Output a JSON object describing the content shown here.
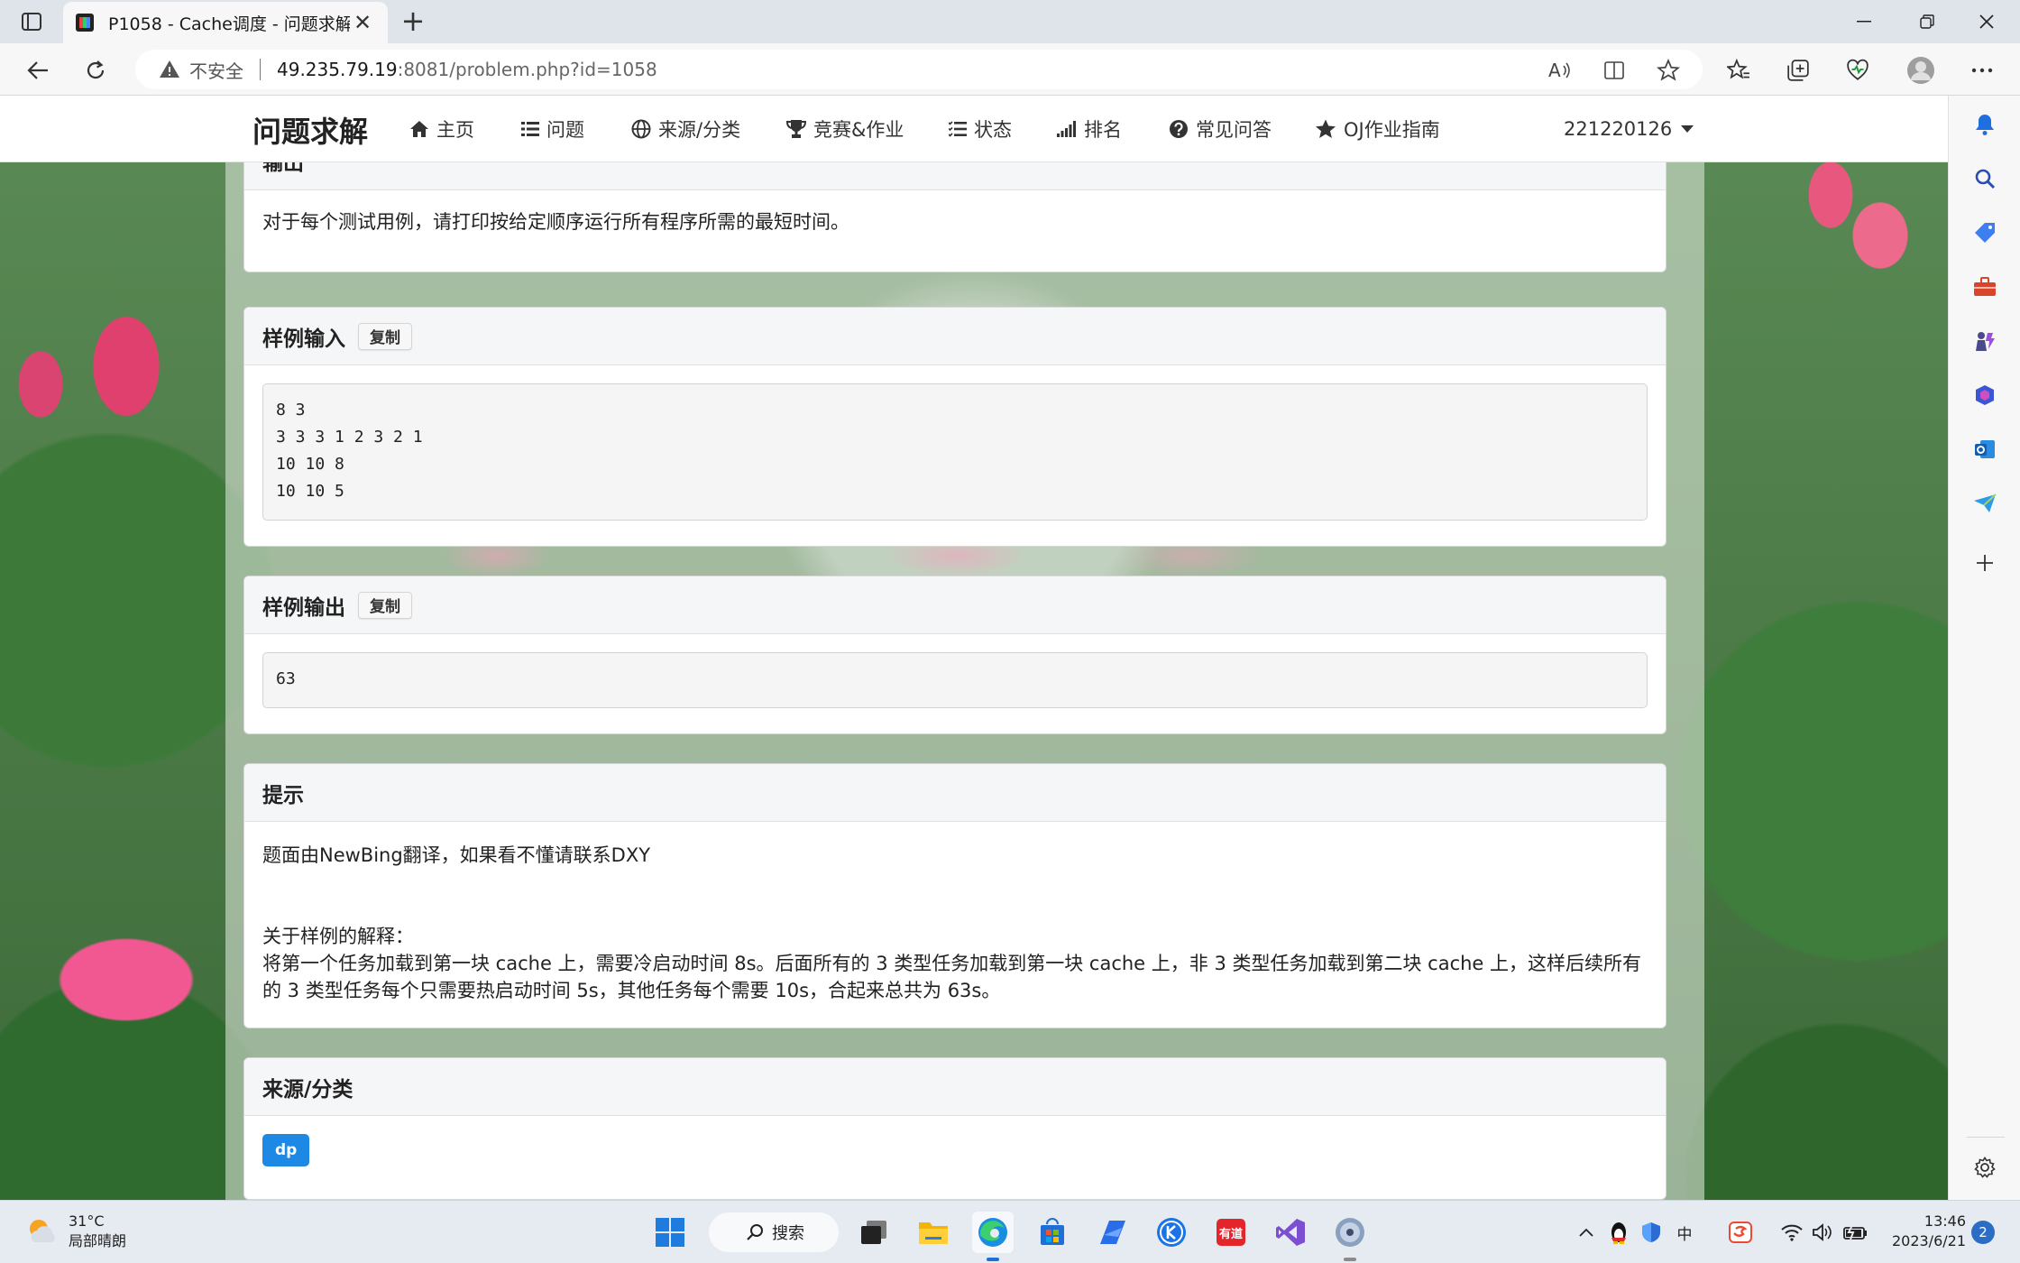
{
  "browser": {
    "tab_title": "P1058 - Cache调度 - 问题求解",
    "url_warning": "不安全",
    "url_host": "49.235.79.19",
    "url_path": ":8081/problem.php?id=1058"
  },
  "site": {
    "brand": "问题求解",
    "nav": [
      {
        "label": "主页",
        "icon": "home-icon"
      },
      {
        "label": "问题",
        "icon": "list-icon"
      },
      {
        "label": "来源/分类",
        "icon": "globe-icon"
      },
      {
        "label": "竞赛&作业",
        "icon": "trophy-icon"
      },
      {
        "label": "状态",
        "icon": "tasks-icon"
      },
      {
        "label": "排名",
        "icon": "signal-icon"
      },
      {
        "label": "常见问答",
        "icon": "question-icon"
      },
      {
        "label": "OJ作业指南",
        "icon": "star-icon"
      }
    ],
    "user": "221220126"
  },
  "problem": {
    "output_title": "输出",
    "output_text": "对于每个测试用例，请打印按给定顺序运行所有程序所需的最短时间。",
    "sample_input_title": "样例输入",
    "sample_output_title": "样例输出",
    "copy_label": "复制",
    "sample_input_lines": [
      "8 3",
      "3 3 3 1 2 3 2 1",
      "10 10 8",
      "10 10 5"
    ],
    "sample_output": "63",
    "hint_title": "提示",
    "hint_line1": "题面由NewBing翻译，如果看不懂请联系DXY",
    "hint_line2": "关于样例的解释：",
    "hint_line3": "将第一个任务加载到第一块 cache 上，需要冷启动时间 8s。后面所有的 3 类型任务加载到第一块 cache 上，非 3 类型任务加载到第二块 cache 上，这样后续所有的 3 类型任务每个只需要热启动时间 5s，其他任务每个需要 10s，合起来总共为 63s。",
    "source_title": "来源/分类",
    "source_tag": "dp"
  },
  "taskbar": {
    "temperature": "31°C",
    "weather": "局部晴朗",
    "search_label": "搜索",
    "ime": "中",
    "time": "13:46",
    "date": "2023/6/21",
    "notifications": "2"
  }
}
